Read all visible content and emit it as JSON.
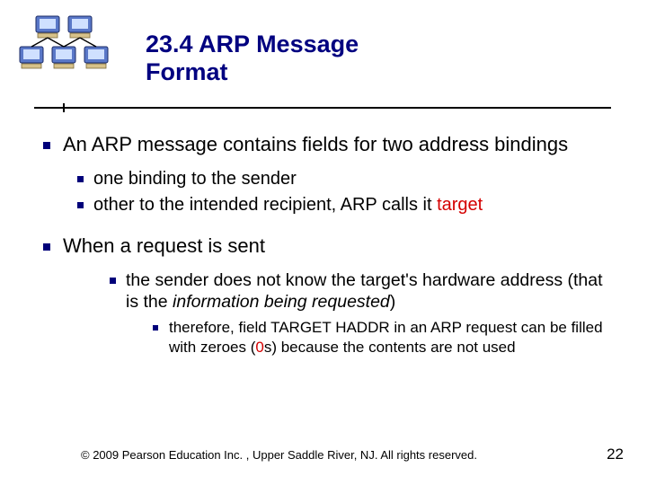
{
  "title": "23.4  ARP Message\n          Format",
  "bullets": {
    "p1": "An ARP message contains fields for two address bindings",
    "p1a": "one binding to the sender",
    "p1b_pre": "other to the intended recipient, ARP calls it ",
    "p1b_target": "target",
    "p2": "When a request is sent",
    "p2a_pre": "the sender does not know the target's hardware address (that is the ",
    "p2a_ital": "information being requested",
    "p2a_post": ")",
    "p2a1_pre": "therefore, field TARGET HADDR in an ARP request can be filled with zeroes (",
    "p2a1_red": "0",
    "p2a1_post": "s) because the contents are not used"
  },
  "footer": "© 2009 Pearson Education Inc. , Upper Saddle River, NJ. All rights reserved.",
  "page": "22"
}
